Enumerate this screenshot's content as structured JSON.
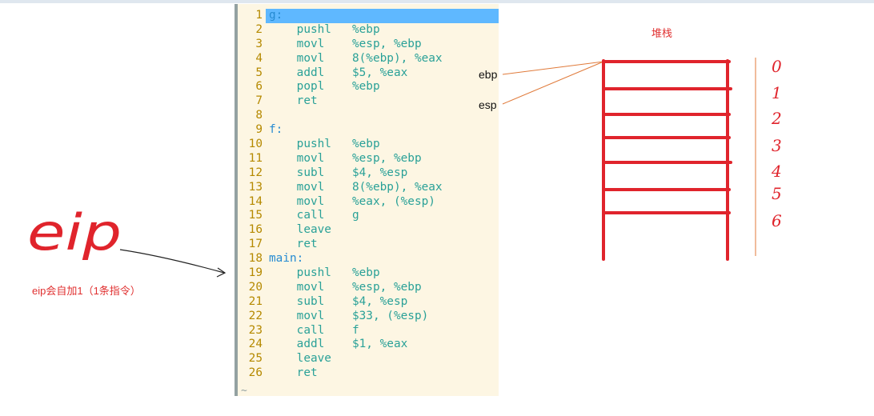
{
  "editor": {
    "lines": [
      {
        "n": "1",
        "code": "g:"
      },
      {
        "n": "2",
        "code": "    pushl   %ebp"
      },
      {
        "n": "3",
        "code": "    movl    %esp, %ebp"
      },
      {
        "n": "4",
        "code": "    movl    8(%ebp), %eax"
      },
      {
        "n": "5",
        "code": "    addl    $5, %eax"
      },
      {
        "n": "6",
        "code": "    popl    %ebp"
      },
      {
        "n": "7",
        "code": "    ret"
      },
      {
        "n": "8",
        "code": ""
      },
      {
        "n": "9",
        "code": "f:"
      },
      {
        "n": "10",
        "code": "    pushl   %ebp"
      },
      {
        "n": "11",
        "code": "    movl    %esp, %ebp"
      },
      {
        "n": "12",
        "code": "    subl    $4, %esp"
      },
      {
        "n": "13",
        "code": "    movl    8(%ebp), %eax"
      },
      {
        "n": "14",
        "code": "    movl    %eax, (%esp)"
      },
      {
        "n": "15",
        "code": "    call    g"
      },
      {
        "n": "16",
        "code": "    leave"
      },
      {
        "n": "17",
        "code": "    ret"
      },
      {
        "n": "18",
        "code": "main:"
      },
      {
        "n": "19",
        "code": "    pushl   %ebp"
      },
      {
        "n": "20",
        "code": "    movl    %esp, %ebp"
      },
      {
        "n": "21",
        "code": "    subl    $4, %esp"
      },
      {
        "n": "22",
        "code": "    movl    $33, (%esp)"
      },
      {
        "n": "23",
        "code": "    call    f"
      },
      {
        "n": "24",
        "code": "    addl    $1, %eax"
      },
      {
        "n": "25",
        "code": "    leave"
      },
      {
        "n": "26",
        "code": "    ret"
      }
    ],
    "empty_line_marker": "~"
  },
  "annotations": {
    "stack_title": "堆栈",
    "ebp_label": "ebp",
    "esp_label": "esp",
    "eip_handwritten": "eip",
    "eip_note": "eip会自加1（1条指令）",
    "slot_numbers": [
      "0",
      "1",
      "2",
      "3",
      "4",
      "5",
      "6"
    ]
  },
  "colors": {
    "stack_red": "#e0242c",
    "pointer_orange": "#e07a3a",
    "editor_bg": "#fdf6e3",
    "line_number": "#b58900",
    "code_teal": "#2aa198",
    "selection_blue": "#5fb8ff"
  }
}
